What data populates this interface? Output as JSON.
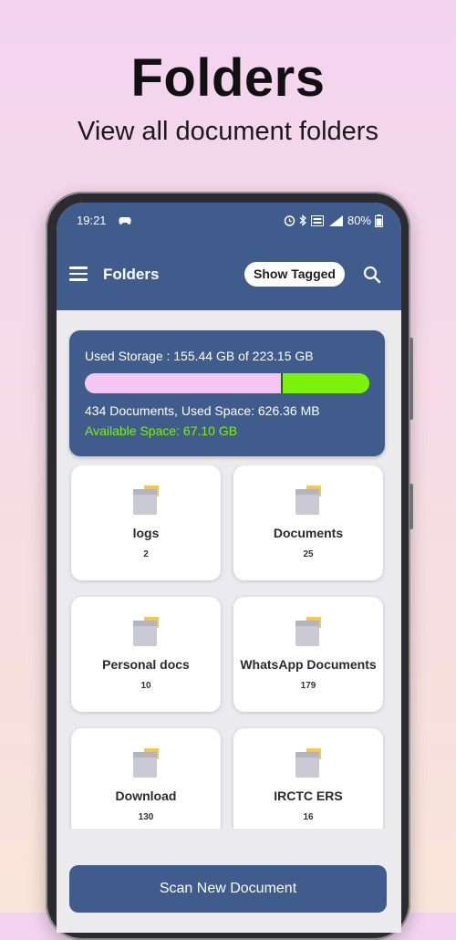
{
  "promo": {
    "title": "Folders",
    "subtitle": "View all document folders"
  },
  "status_bar": {
    "time": "19:21",
    "battery": "80%",
    "icons": [
      "game-controller-icon",
      "alarm-icon",
      "bluetooth-icon",
      "volte-icon",
      "signal-icon",
      "battery-icon"
    ]
  },
  "toolbar": {
    "title": "Folders",
    "show_tagged_label": "Show Tagged",
    "icons": [
      "menu-icon",
      "search-icon"
    ]
  },
  "storage": {
    "used_text": "Used Storage :  155.44 GB of 223.15 GB",
    "used_fraction": 0.6966,
    "documents_text": "434 Documents, Used Space: 626.36 MB",
    "available_text": "Available Space: 67.10 GB"
  },
  "folders": [
    {
      "name": "logs",
      "count": "2"
    },
    {
      "name": "Documents",
      "count": "25"
    },
    {
      "name": "Personal docs",
      "count": "10"
    },
    {
      "name": "WhatsApp Documents",
      "count": "179"
    },
    {
      "name": "Download",
      "count": "130"
    },
    {
      "name": "IRCTC ERS",
      "count": "16"
    }
  ],
  "scan_button_label": "Scan New Document",
  "colors": {
    "primary": "#405c8c",
    "available_green": "#7cf20b",
    "used_pink": "#f4c6f4"
  }
}
